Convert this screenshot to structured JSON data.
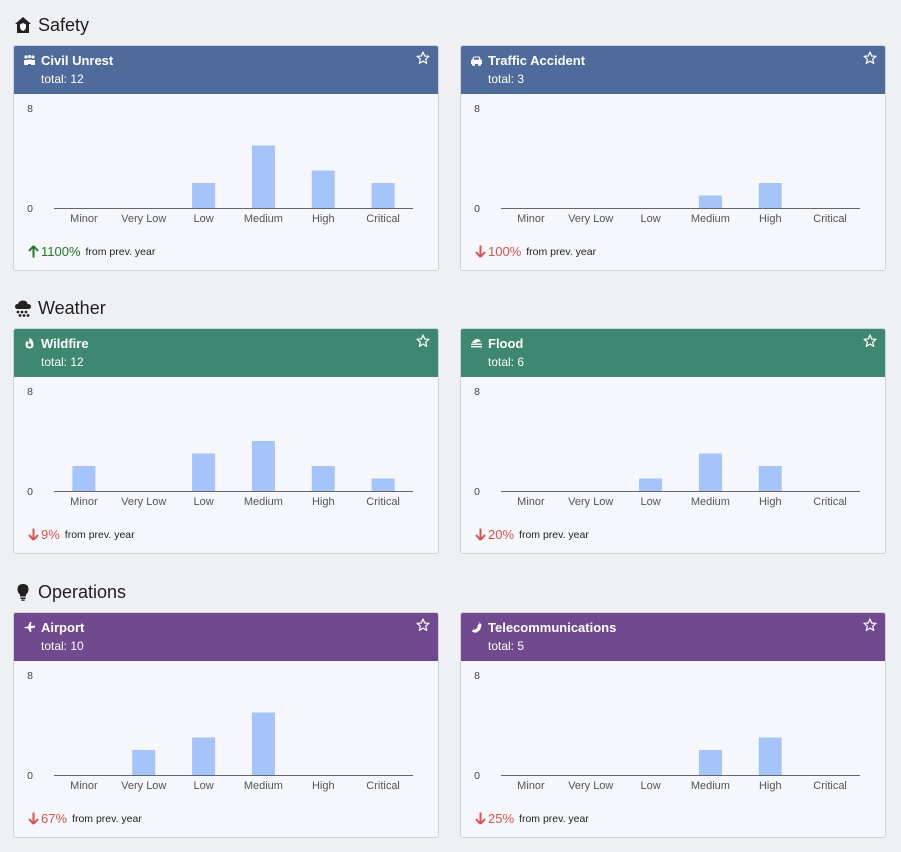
{
  "colors": {
    "safety": "#4f6b9b",
    "weather": "#3e8770",
    "operations": "#70498e",
    "bar": "#a4c4fa",
    "up": "#1f7a22",
    "down": "#d9534f"
  },
  "levels": [
    "Minor",
    "Very Low",
    "Low",
    "Medium",
    "High",
    "Critical"
  ],
  "y_max_label": "8",
  "y_min_label": "0",
  "prev_year_label": "from prev. year",
  "sections": [
    {
      "title": "Safety",
      "icon": "house-shield-icon",
      "color": "safety",
      "cards": [
        {
          "title": "Civil Unrest",
          "icon": "crowd-icon",
          "total": "total: 12",
          "change": "1100%",
          "direction": "up",
          "values": [
            0,
            0,
            2,
            5,
            3,
            2
          ]
        },
        {
          "title": "Traffic Accident",
          "icon": "car-icon",
          "total": "total: 3",
          "change": "100%",
          "direction": "down",
          "values": [
            0,
            0,
            0,
            1,
            2,
            0
          ]
        }
      ]
    },
    {
      "title": "Weather",
      "icon": "cloud-rain-icon",
      "color": "weather",
      "cards": [
        {
          "title": "Wildfire",
          "icon": "fire-icon",
          "total": "total: 12",
          "change": "9%",
          "direction": "down",
          "values": [
            2,
            0,
            3,
            4,
            2,
            1
          ]
        },
        {
          "title": "Flood",
          "icon": "water-icon",
          "total": "total: 6",
          "change": "20%",
          "direction": "down",
          "values": [
            0,
            0,
            1,
            3,
            2,
            0
          ]
        }
      ]
    },
    {
      "title": "Operations",
      "icon": "lightbulb-icon",
      "color": "operations",
      "cards": [
        {
          "title": "Airport",
          "icon": "plane-icon",
          "total": "total: 10",
          "change": "67%",
          "direction": "down",
          "values": [
            0,
            2,
            3,
            5,
            0,
            0
          ]
        },
        {
          "title": "Telecommunications",
          "icon": "phone-icon",
          "total": "total: 5",
          "change": "25%",
          "direction": "down",
          "values": [
            0,
            0,
            0,
            2,
            3,
            0
          ]
        }
      ]
    }
  ]
}
